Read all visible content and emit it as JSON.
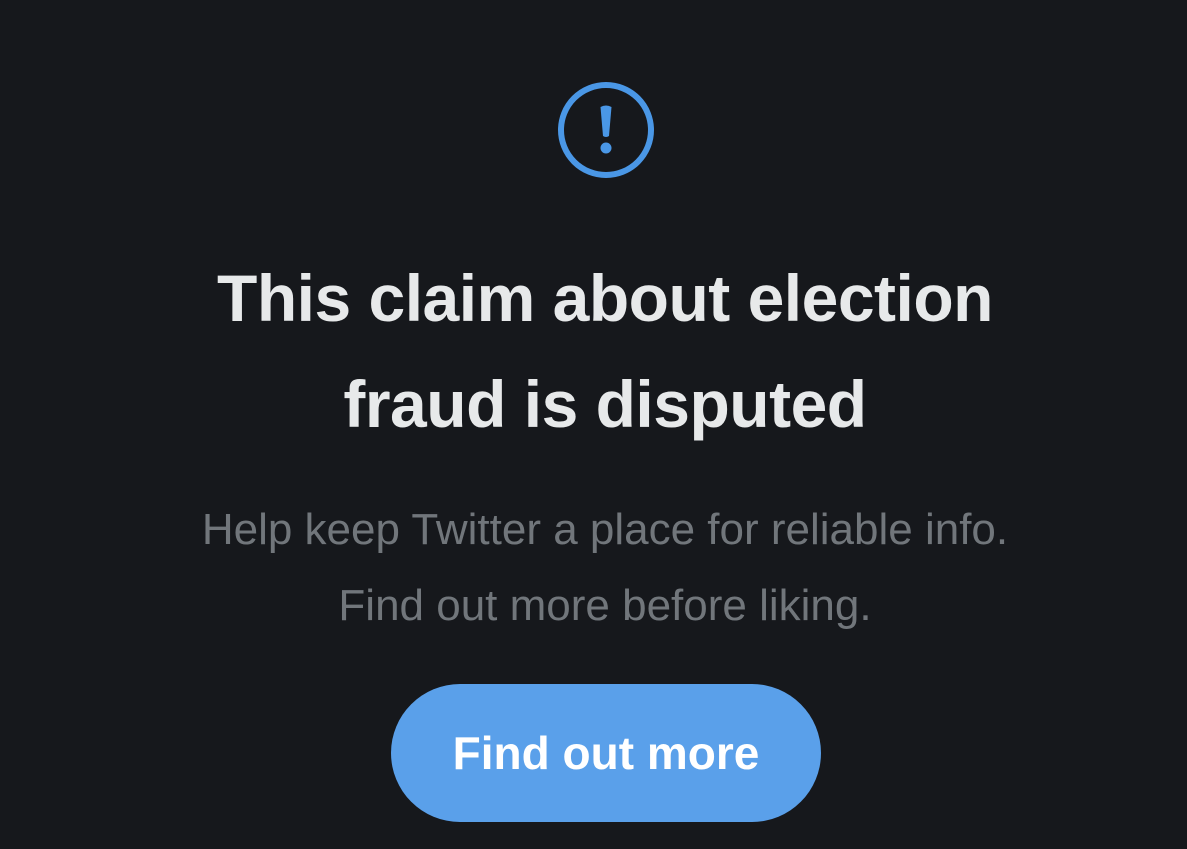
{
  "warning": {
    "icon": "alert-exclamation-icon",
    "accent_color": "#4a97e6",
    "headline_line1": "This claim about election",
    "headline_line2": "fraud is disputed",
    "body_line1": "Help keep Twitter a place for reliable info.",
    "body_line2": "Find out more before liking.",
    "button_label": "Find out more",
    "button_color": "#5aa0ea"
  }
}
